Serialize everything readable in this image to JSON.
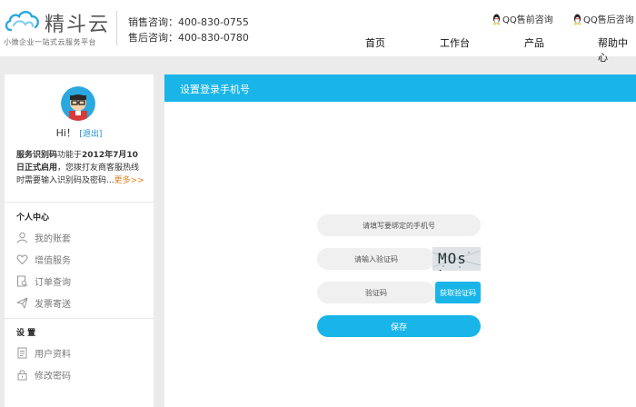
{
  "header": {
    "logo_name": "精斗云",
    "logo_tagline": "小微企业一站式云服务平台",
    "sales_contact": "销售咨询：400-830-0755",
    "aftersales_contact": "售后咨询：400-830-0780",
    "qq_presales": "QQ售前咨询",
    "qq_aftersales": "QQ售后咨询",
    "nav": [
      "首页",
      "工作台",
      "产品",
      "帮助中心"
    ]
  },
  "sidebar": {
    "greeting": "Hi！",
    "logout": "[退出]",
    "notice_strong1": "服务识别码",
    "notice_mid": "功能于",
    "notice_strong2": "2012年7月10日正式启用",
    "notice_rest": "，您拨打友商客服热线时需要输入识别码及密码...",
    "notice_more": "更多>>",
    "personal_center": "个人中心",
    "personal_items": [
      "我的账套",
      "增值服务",
      "订单查询",
      "发票寄送"
    ],
    "settings": "设 置",
    "settings_items": [
      "用户资料",
      "修改密码"
    ]
  },
  "panel": {
    "title": "设置登录手机号",
    "phone_placeholder": "请填写要绑定的手机号",
    "captcha_placeholder": "请输入验证码",
    "captcha_text": "MOs k",
    "code_placeholder": "验证码",
    "get_code_label": "获取验证码",
    "save_label": "保存"
  },
  "colors": {
    "accent": "#19b4e8",
    "more_link": "#e08020",
    "logout_link": "#1a8fd6",
    "background": "#ebebeb"
  }
}
